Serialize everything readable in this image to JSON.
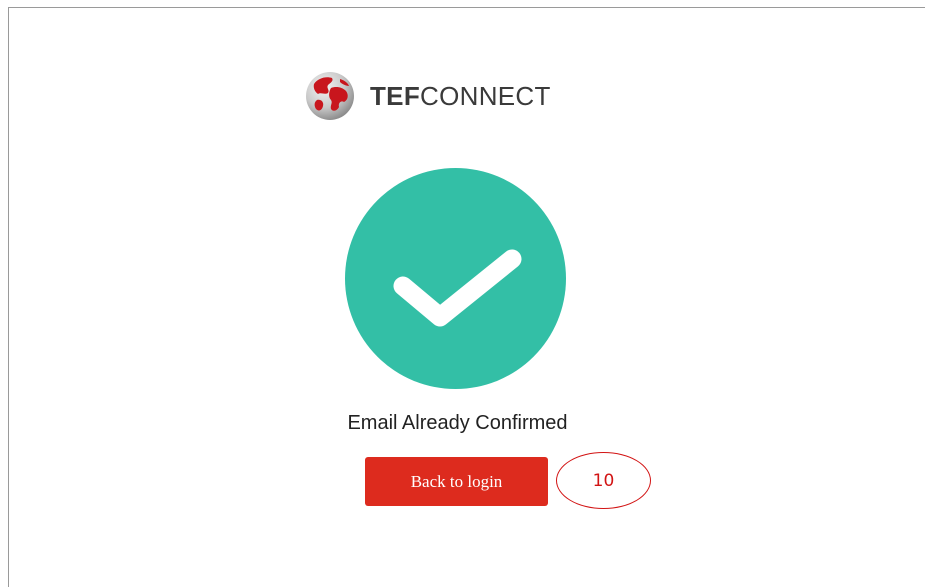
{
  "brand": {
    "name_bold": "TEF",
    "name_regular": "CONNECT",
    "logo_icon": "globe-icon"
  },
  "status": {
    "icon": "check-circle-icon",
    "message": "Email Already Confirmed"
  },
  "actions": {
    "back_label": "Back to login"
  },
  "annotation": {
    "label": "10"
  },
  "colors": {
    "accent_red": "#dd2b1e",
    "success_teal": "#33bfa6",
    "annotation_red": "#d21414"
  }
}
